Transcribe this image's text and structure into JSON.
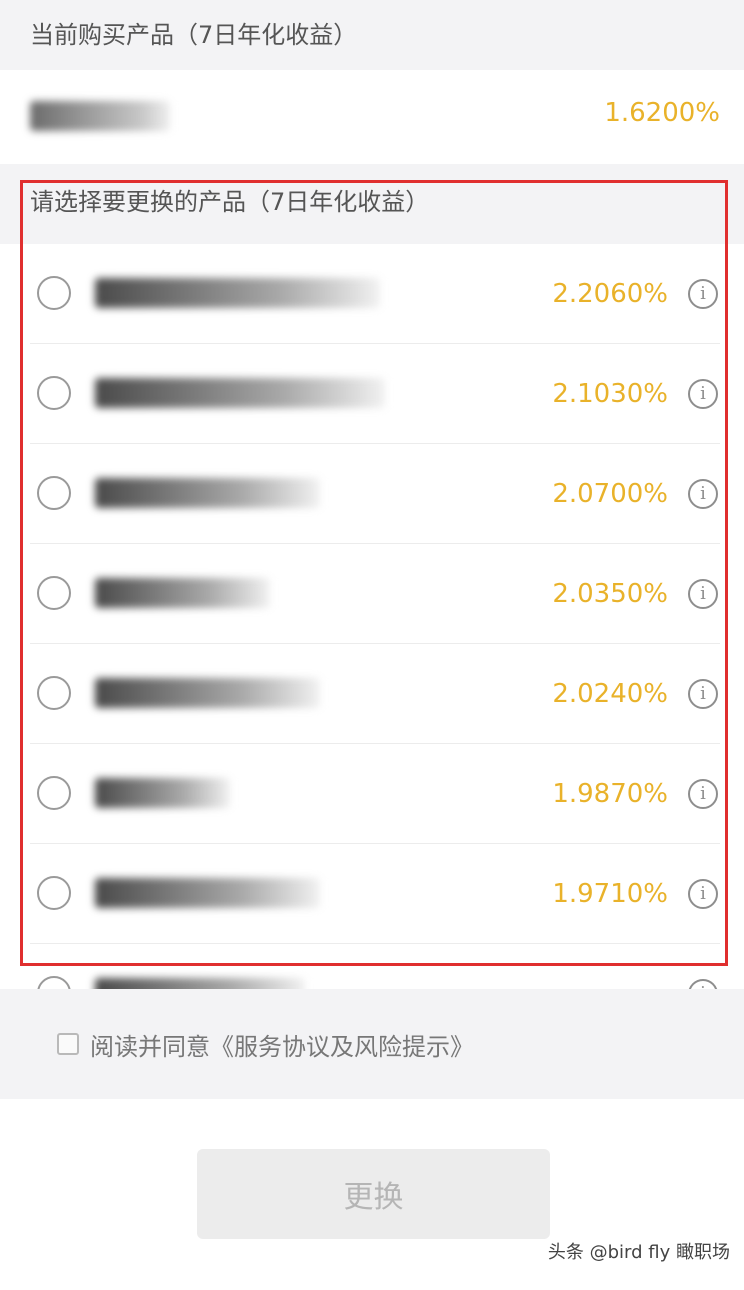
{
  "current_section": {
    "title": "当前购买产品（7日年化收益）",
    "product_rate": "1.6200%"
  },
  "select_section": {
    "title": "请选择要更换的产品（7日年化收益）",
    "products": [
      {
        "rate": "2.2060%",
        "info_icon": "info-circle-icon"
      },
      {
        "rate": "2.1030%",
        "info_icon": "info-circle-icon"
      },
      {
        "rate": "2.0700%",
        "info_icon": "info-circle-icon"
      },
      {
        "rate": "2.0350%",
        "info_icon": "info-circle-icon"
      },
      {
        "rate": "2.0240%",
        "info_icon": "info-circle-icon"
      },
      {
        "rate": "1.9870%",
        "info_icon": "info-circle-icon"
      },
      {
        "rate": "1.9710%",
        "info_icon": "info-circle-icon"
      }
    ]
  },
  "agreement": {
    "text": "阅读并同意《服务协议及风险提示》",
    "checked": false
  },
  "submit_button": {
    "label": "更换",
    "enabled": false
  },
  "watermark": "头条 @bird fly 瞰职场",
  "colors": {
    "rate": "#e9b22a",
    "highlight_frame": "#e02f2f",
    "background": "#f3f3f5"
  }
}
